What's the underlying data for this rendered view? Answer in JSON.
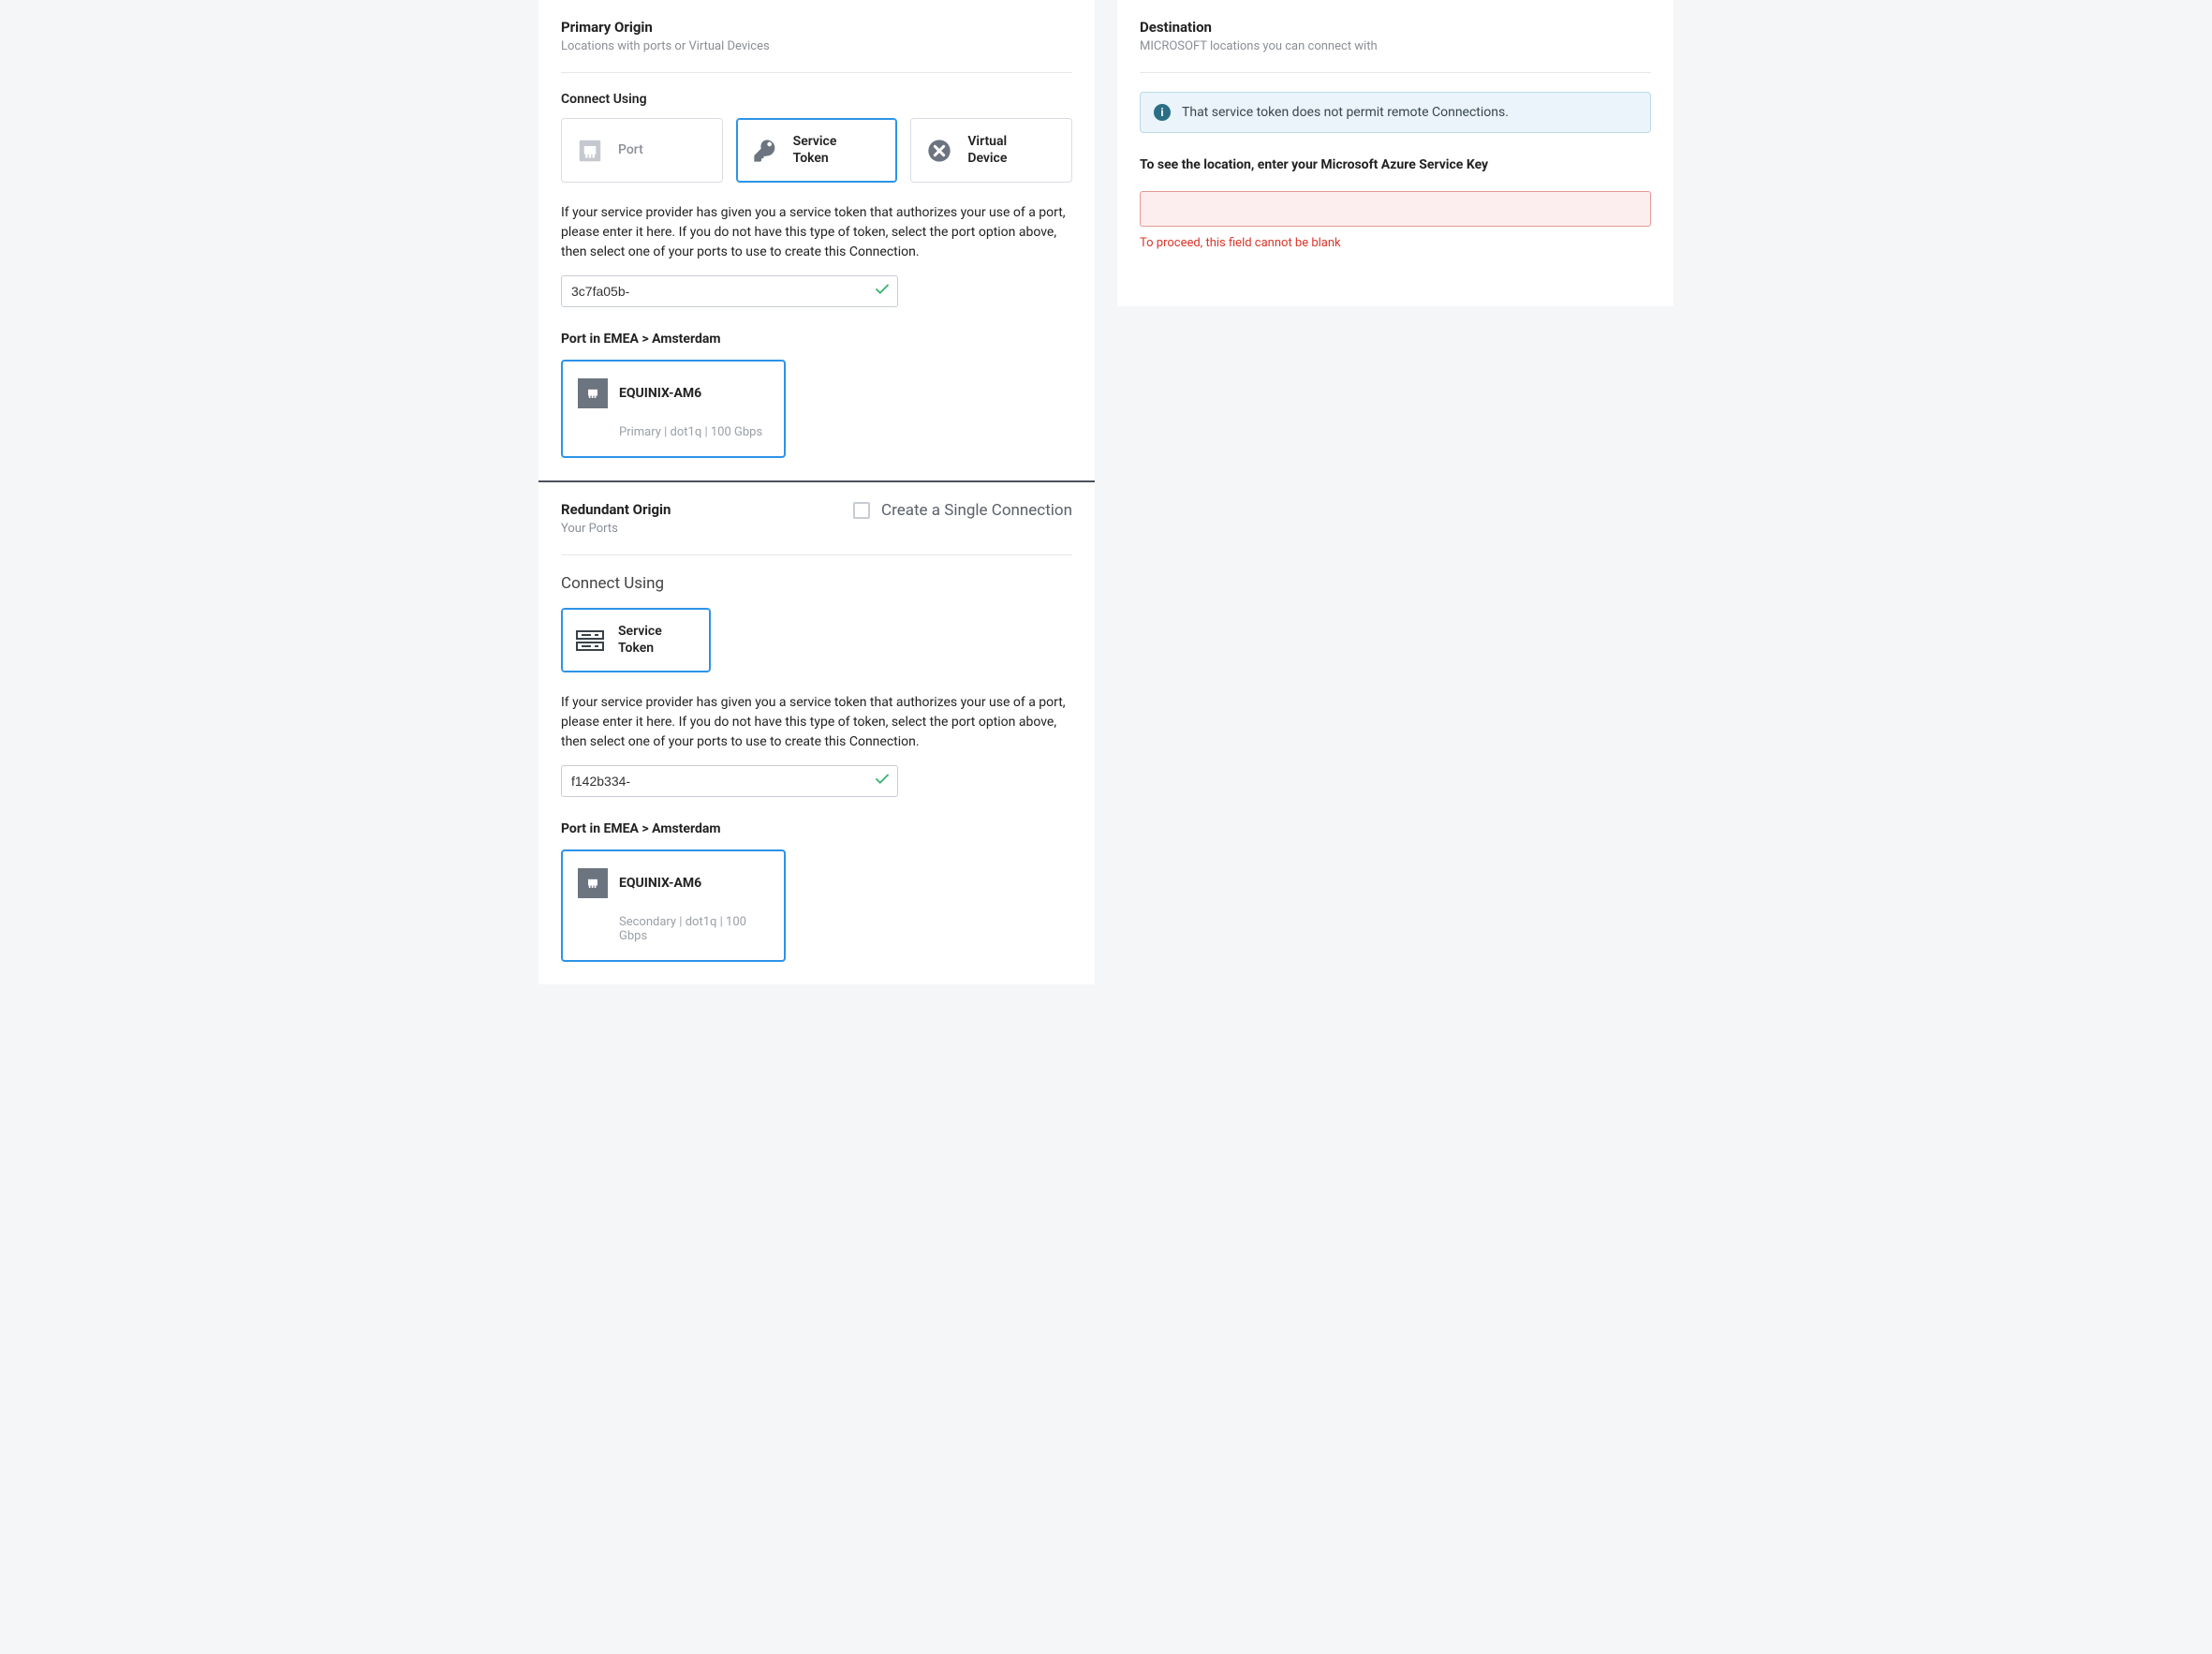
{
  "primary": {
    "title": "Primary Origin",
    "subtitle": "Locations with ports or Virtual Devices",
    "connect_label": "Connect Using",
    "tiles": {
      "port": "Port",
      "service_token": "Service\nToken",
      "virtual_device": "Virtual\nDevice"
    },
    "help": "If your service provider has given you a service token that authorizes your use of a port, please enter it here. If you do not have this type of token, select the port option above, then select one of your ports to use to create this Connection.",
    "token_value": "3c7fa05b-",
    "port_heading": "Port in EMEA > Amsterdam",
    "port_card": {
      "name": "EQUINIX-AM6",
      "meta": "Primary | dot1q | 100 Gbps"
    }
  },
  "redundant": {
    "title": "Redundant Origin",
    "subtitle": "Your Ports",
    "single_label": "Create a Single Connection",
    "connect_label": "Connect Using",
    "tile_label": "Service\nToken",
    "help": "If your service provider has given you a service token that authorizes your use of a port, please enter it here. If you do not have this type of token, select the port option above, then select one of your ports to use to create this Connection.",
    "token_value": "f142b334-",
    "port_heading": "Port in EMEA > Amsterdam",
    "port_card": {
      "name": "EQUINIX-AM6",
      "meta": "Secondary | dot1q | 100 Gbps"
    }
  },
  "destination": {
    "title": "Destination",
    "subtitle": "MICROSOFT locations you can connect with",
    "alert": "That service token does not permit remote Connections.",
    "instruction": "To see the location, enter your Microsoft Azure Service Key",
    "error": "To proceed, this field cannot be blank"
  }
}
